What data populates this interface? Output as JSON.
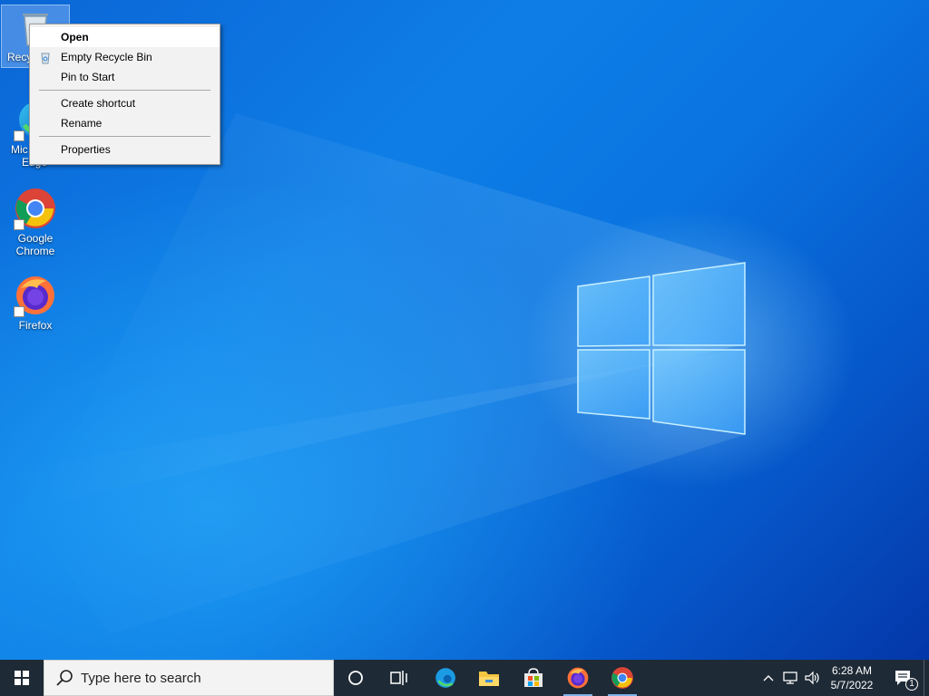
{
  "desktop": {
    "icons": [
      {
        "label": "Recycle Bin",
        "visible_label": "Recy",
        "selected": true
      },
      {
        "label": "Microsoft Edge",
        "visible_label_line1": "Mic",
        "visible_label_line2": "Edge"
      },
      {
        "label": "Google Chrome",
        "line1": "Google",
        "line2": "Chrome"
      },
      {
        "label": "Firefox",
        "line1": "Firefox"
      }
    ]
  },
  "context_menu": {
    "items": [
      {
        "label": "Open",
        "bold": true,
        "highlighted": true
      },
      {
        "label": "Empty Recycle Bin",
        "icon": "recycle-bin-small-icon"
      },
      {
        "label": "Pin to Start"
      },
      {
        "separator": true
      },
      {
        "label": "Create shortcut"
      },
      {
        "label": "Rename"
      },
      {
        "separator": true
      },
      {
        "label": "Properties"
      }
    ]
  },
  "taskbar": {
    "search_placeholder": "Type here to search",
    "pinned_apps": [
      "cortana-icon",
      "task-view-icon",
      "edge-icon",
      "file-explorer-icon",
      "microsoft-store-icon",
      "firefox-icon",
      "chrome-icon"
    ],
    "tray": {
      "time": "6:28 AM",
      "date": "5/7/2022",
      "notification_count": "1"
    }
  },
  "colors": {
    "taskbar_bg": "#1e2a36",
    "menu_bg": "#f2f2f2",
    "menu_highlight": "#ffffff",
    "running_indicator": "#7fb2e8"
  }
}
